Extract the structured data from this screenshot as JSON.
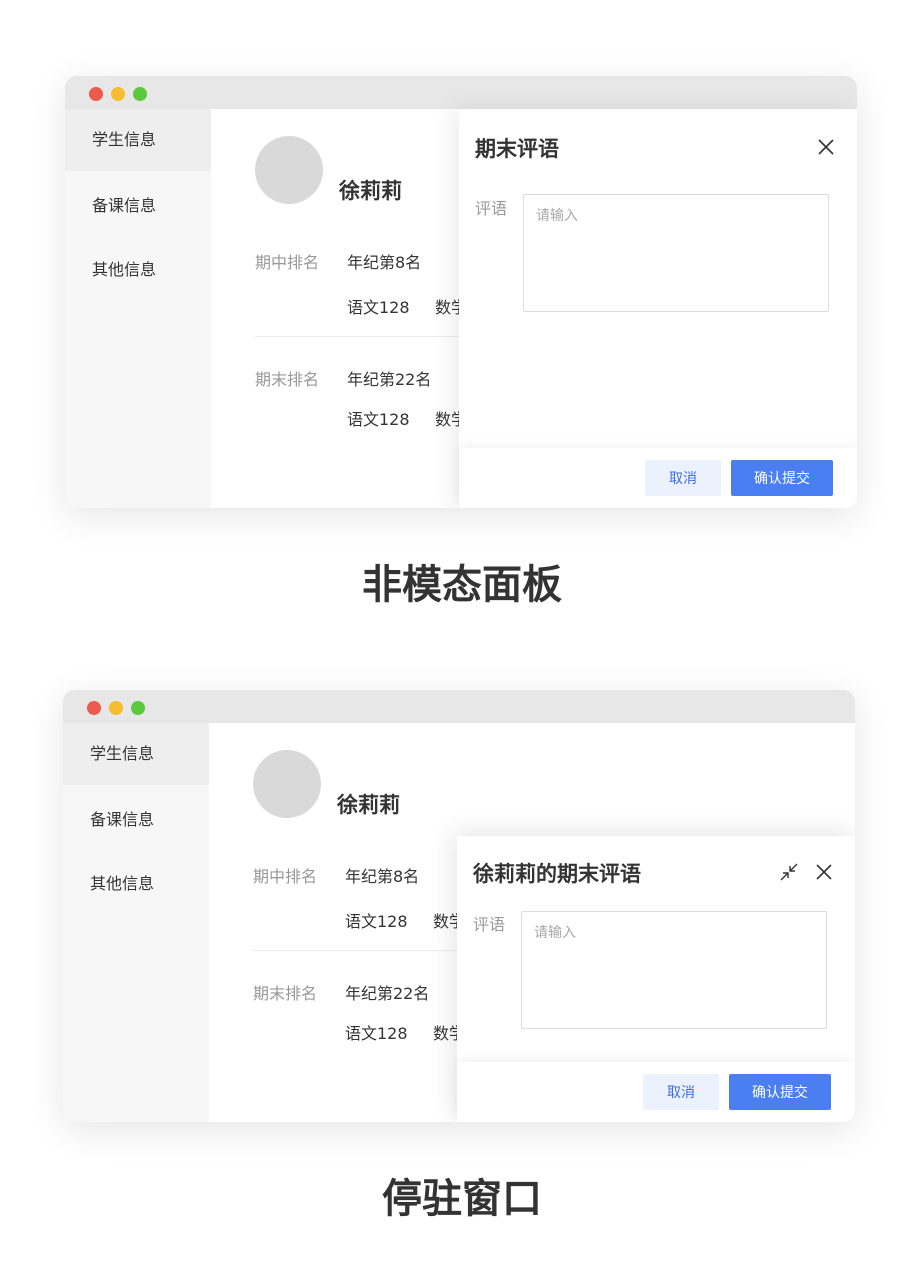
{
  "sidebar": {
    "items": [
      {
        "label": "学生信息"
      },
      {
        "label": "备课信息"
      },
      {
        "label": "其他信息"
      }
    ]
  },
  "student": {
    "name": "徐莉莉",
    "midterm": {
      "label": "期中排名",
      "rank": "年纪第8名",
      "score_chinese": "语文128",
      "score_math": "数学"
    },
    "final": {
      "label": "期末排名",
      "rank": "年纪第22名",
      "score_chinese": "语文128",
      "score_math": "数学"
    }
  },
  "panel1": {
    "title": "期末评语",
    "field_label": "评语",
    "placeholder": "请输入",
    "cancel_label": "取消",
    "submit_label": "确认提交"
  },
  "panel2": {
    "title": "徐莉莉的期末评语",
    "field_label": "评语",
    "placeholder": "请输入",
    "cancel_label": "取消",
    "submit_label": "确认提交"
  },
  "captions": {
    "top": "非模态面板",
    "bottom": "停驻窗口"
  }
}
